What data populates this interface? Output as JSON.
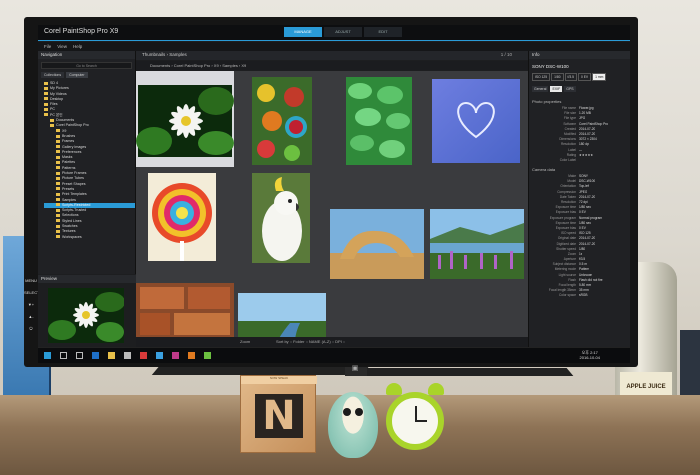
{
  "app": {
    "title": "Corel PaintShop Pro X9",
    "mode_tabs": [
      "MANAGE",
      "ADJUST",
      "EDIT"
    ],
    "menu": [
      "File",
      "View",
      "Help"
    ]
  },
  "navigation": {
    "header": "Navigation",
    "search_placeholder": "Go to Search",
    "tabs": [
      "Collections",
      "Computer"
    ],
    "tree": [
      "SD 4",
      "My Pictures",
      "My Videos",
      "Desktop",
      "Files",
      "PC",
      "PC 본인",
      "Documents",
      "Corel PaintShop Pro",
      "X9",
      "Brushes",
      "Frames",
      "Gallery Images",
      "Preferences",
      "Masks",
      "Palettes",
      "Patterns",
      "Picture Frames",
      "Picture Tubes",
      "Preset Shapes",
      "Presets",
      "Print Templates",
      "Samples",
      "Scripts-Restricted",
      "Scripts-Trusted",
      "Selections",
      "Styled Lines",
      "Swatches",
      "Textures",
      "Workspaces"
    ],
    "selected_index": 23
  },
  "preview": {
    "header": "Preview"
  },
  "osd_buttons": [
    "MENU",
    "SELECT",
    "▼+",
    "▲-",
    "⏻"
  ],
  "content": {
    "breadcrumb": [
      "Thumbnails",
      "Samples"
    ],
    "count": "1 / 10",
    "path": "Documents › Corel PaintShop Pro › X9 › Samples › X9"
  },
  "status": {
    "zoom": "Zoom",
    "sort": "Sort by :: Folder :: NAME (A-Z) :: DPI ::"
  },
  "info": {
    "header": "Info",
    "camera": "SONY DSC-W100",
    "badges": [
      "ISO 125",
      "1/80",
      "f/3.5",
      "0 EV",
      "1 mm"
    ],
    "tabs": [
      "General",
      "EXIF",
      "GPS"
    ],
    "photo_section": "Photo properties",
    "photo_rows": [
      {
        "k": "File name",
        "v": "Flower.jpg"
      },
      {
        "k": "File size",
        "v": "1.20 MB"
      },
      {
        "k": "File type",
        "v": "JPG"
      },
      {
        "k": "Software",
        "v": "Corel PaintShop Pro"
      },
      {
        "k": "Created",
        "v": "2014-07-20"
      },
      {
        "k": "Modified",
        "v": "2014-07-20"
      },
      {
        "k": "Dimensions",
        "v": "3072 × 2304"
      },
      {
        "k": "Resolution",
        "v": "180 dpi"
      },
      {
        "k": "Label",
        "v": "—"
      },
      {
        "k": "Rating",
        "v": "★★★★★"
      },
      {
        "k": "Color Label",
        "v": ""
      }
    ],
    "camera_section": "Camera data",
    "camera_rows": [
      {
        "k": "Make",
        "v": "SONY"
      },
      {
        "k": "Model",
        "v": "DSC-W100"
      },
      {
        "k": "Orientation",
        "v": "Top-left"
      },
      {
        "k": "Compression",
        "v": "JPEG"
      },
      {
        "k": "Date Taken",
        "v": "2014-07-20"
      },
      {
        "k": "Resolution",
        "v": "72 dpi"
      },
      {
        "k": "Exposure time",
        "v": "1/80 sec"
      },
      {
        "k": "Exposure bias",
        "v": "0 EV"
      },
      {
        "k": "Exposure program",
        "v": "Normal program"
      },
      {
        "k": "Exposure time",
        "v": "1/80 sec"
      },
      {
        "k": "Exposure bias",
        "v": "0 EV"
      },
      {
        "k": "ISO speed",
        "v": "ISO 125"
      },
      {
        "k": "Original date",
        "v": "2014-07-20"
      },
      {
        "k": "Digitized date",
        "v": "2014-07-20"
      },
      {
        "k": "Shutter speed",
        "v": "1/80"
      },
      {
        "k": "Zoom",
        "v": "1x"
      },
      {
        "k": "Aperture",
        "v": "f/3.5"
      },
      {
        "k": "Subject distance",
        "v": "0.5 m"
      },
      {
        "k": "Metering mode",
        "v": "Pattern"
      },
      {
        "k": "Light source",
        "v": "Unknown"
      },
      {
        "k": "Flash",
        "v": "Flash did not fire"
      },
      {
        "k": "Focal length",
        "v": "5.80 mm"
      },
      {
        "k": "Focal length 35mm",
        "v": "35 mm"
      },
      {
        "k": "Color space",
        "v": "sRGB"
      }
    ]
  },
  "taskbar": {
    "time": "오후 2:17",
    "date": "2016-10-04"
  },
  "desk": {
    "block_letter": "N",
    "block_caption": "NOW SPEAK",
    "bottle_label": "APPLE JUICE"
  },
  "colors": {
    "accent": "#2a9bd7",
    "clock_green": "#a9d42a"
  }
}
